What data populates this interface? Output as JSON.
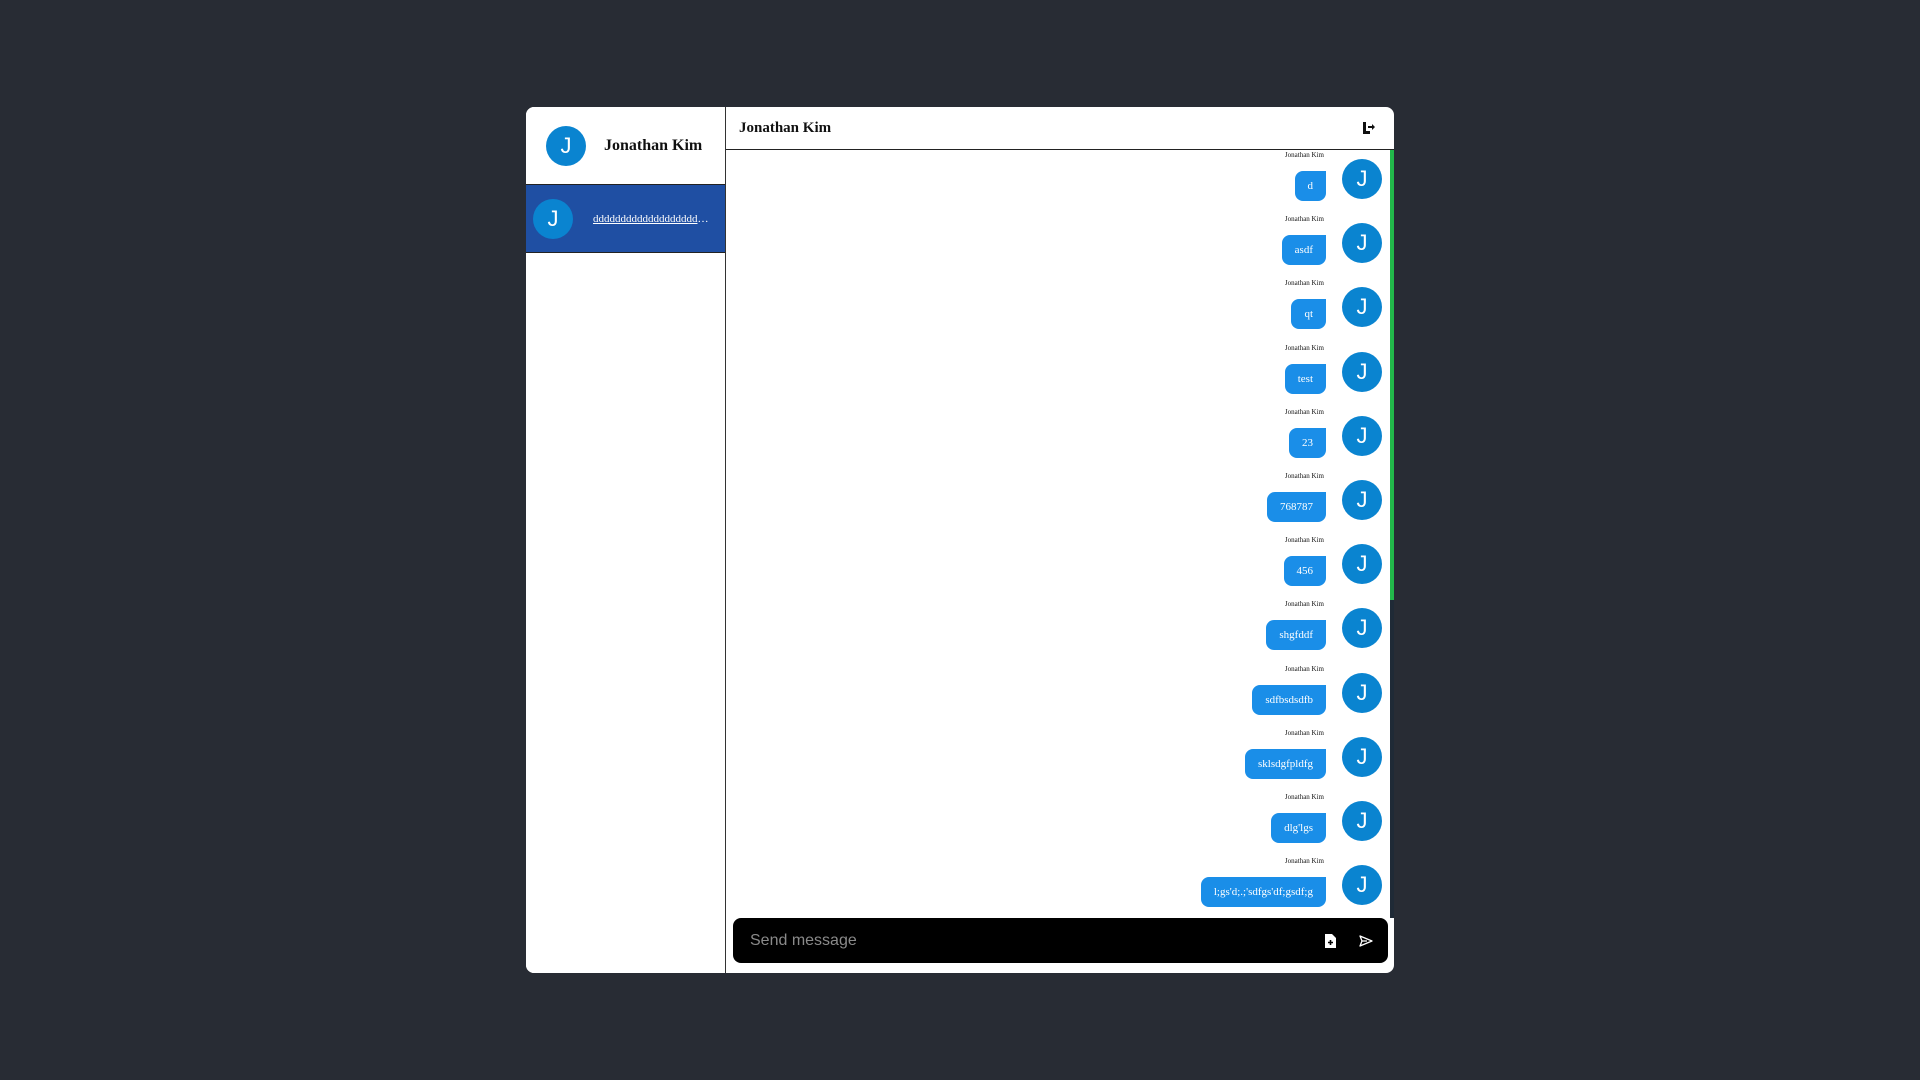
{
  "sidebar": {
    "user": {
      "avatar_initial": "J",
      "name": "Jonathan Kim"
    },
    "conversations": [
      {
        "avatar_initial": "J",
        "name": "dddddddddddddddddddddddddddd"
      }
    ]
  },
  "chat": {
    "title": "Jonathan Kim",
    "messages": [
      {
        "sender": "Jonathan Kim",
        "text": "d",
        "avatar_initial": "J"
      },
      {
        "sender": "Jonathan Kim",
        "text": "asdf",
        "avatar_initial": "J"
      },
      {
        "sender": "Jonathan Kim",
        "text": "qt",
        "avatar_initial": "J"
      },
      {
        "sender": "Jonathan Kim",
        "text": "test",
        "avatar_initial": "J"
      },
      {
        "sender": "Jonathan Kim",
        "text": "23",
        "avatar_initial": "J"
      },
      {
        "sender": "Jonathan Kim",
        "text": "768787",
        "avatar_initial": "J"
      },
      {
        "sender": "Jonathan Kim",
        "text": "456",
        "avatar_initial": "J"
      },
      {
        "sender": "Jonathan Kim",
        "text": "shgfddf",
        "avatar_initial": "J"
      },
      {
        "sender": "Jonathan Kim",
        "text": "sdfbsdsdfb",
        "avatar_initial": "J"
      },
      {
        "sender": "Jonathan Kim",
        "text": "sklsdgfpldfg",
        "avatar_initial": "J"
      },
      {
        "sender": "Jonathan Kim",
        "text": "dlg'lgs",
        "avatar_initial": "J"
      },
      {
        "sender": "Jonathan Kim",
        "text": "l;gs'd;.;'sdfgs'df;gsdf;g",
        "avatar_initial": "J"
      }
    ]
  },
  "composer": {
    "placeholder": "Send message"
  },
  "colors": {
    "background": "#282c34",
    "accent": "#1a8ee8",
    "avatar": "#0a84d0",
    "selected_conversation": "#1f4fa3",
    "scrollbar_thumb": "#22b84a"
  },
  "icons": {
    "header_action": "logout-icon",
    "attach": "file-upload-icon",
    "send": "send-icon"
  }
}
